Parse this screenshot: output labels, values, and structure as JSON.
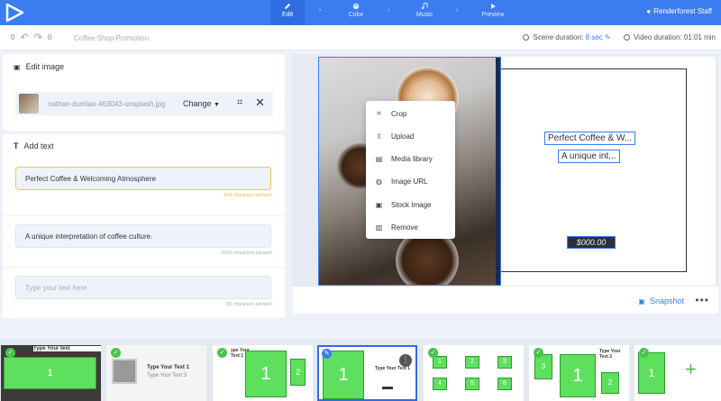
{
  "steps": [
    {
      "label": "Edit",
      "icon": "pencil-icon",
      "active": true
    },
    {
      "label": "Color",
      "icon": "palette-icon",
      "active": false
    },
    {
      "label": "Music",
      "icon": "music-note-icon",
      "active": false
    },
    {
      "label": "Preview",
      "icon": "play-icon",
      "active": false
    }
  ],
  "user": {
    "name": "Renderforest Staff"
  },
  "subbar": {
    "undo_count": "0",
    "redo_count": "0",
    "project_title": "Coffee Shop Promotion",
    "scene_duration_label": "Scene duration:",
    "scene_duration_value": "8 sec",
    "video_duration_label": "Video duration: 01:01 min"
  },
  "edit_image": {
    "title": "Edit image",
    "filename": "nathan-dumlao-463043-unsplash.jpg",
    "change_label": "Change"
  },
  "add_text": {
    "title": "Add text",
    "fields": [
      {
        "value": "Perfect Coffee & Welcoming Atmosphere",
        "hint": "30/4 characters advised"
      },
      {
        "value": "A unique interpretation of coffee culture.",
        "hint": "42/55 characters advised"
      },
      {
        "placeholder": "Type your text here",
        "hint": "0/6 characters advised"
      }
    ]
  },
  "preview": {
    "text1": "Perfect Coffee & W...",
    "text2": "A unique int...",
    "price": "$000.00",
    "snapshot_label": "Snapshot"
  },
  "context_menu": [
    {
      "label": "Crop",
      "icon": "crop-icon"
    },
    {
      "label": "Upload",
      "icon": "upload-icon"
    },
    {
      "label": "Media library",
      "icon": "media-library-icon"
    },
    {
      "label": "Image URL",
      "icon": "globe-icon"
    },
    {
      "label": "Stock Image",
      "icon": "stock-image-icon"
    },
    {
      "label": "Remove",
      "icon": "trash-icon"
    }
  ],
  "timeline": {
    "thumb1_title": "Type Your text",
    "thumb2_title": "Type Your Text 1",
    "thumb2_sub": "Type Your Text 3",
    "thumb3_title": "ype Your Text 1",
    "thumb4_title": "Type Your Text 1",
    "thumb6_title": "Type Your Text 2",
    "numbers": [
      "1",
      "1",
      "2",
      "1",
      "1",
      "2",
      "3",
      "4",
      "5",
      "6",
      "3",
      "1",
      "2",
      "1"
    ]
  }
}
